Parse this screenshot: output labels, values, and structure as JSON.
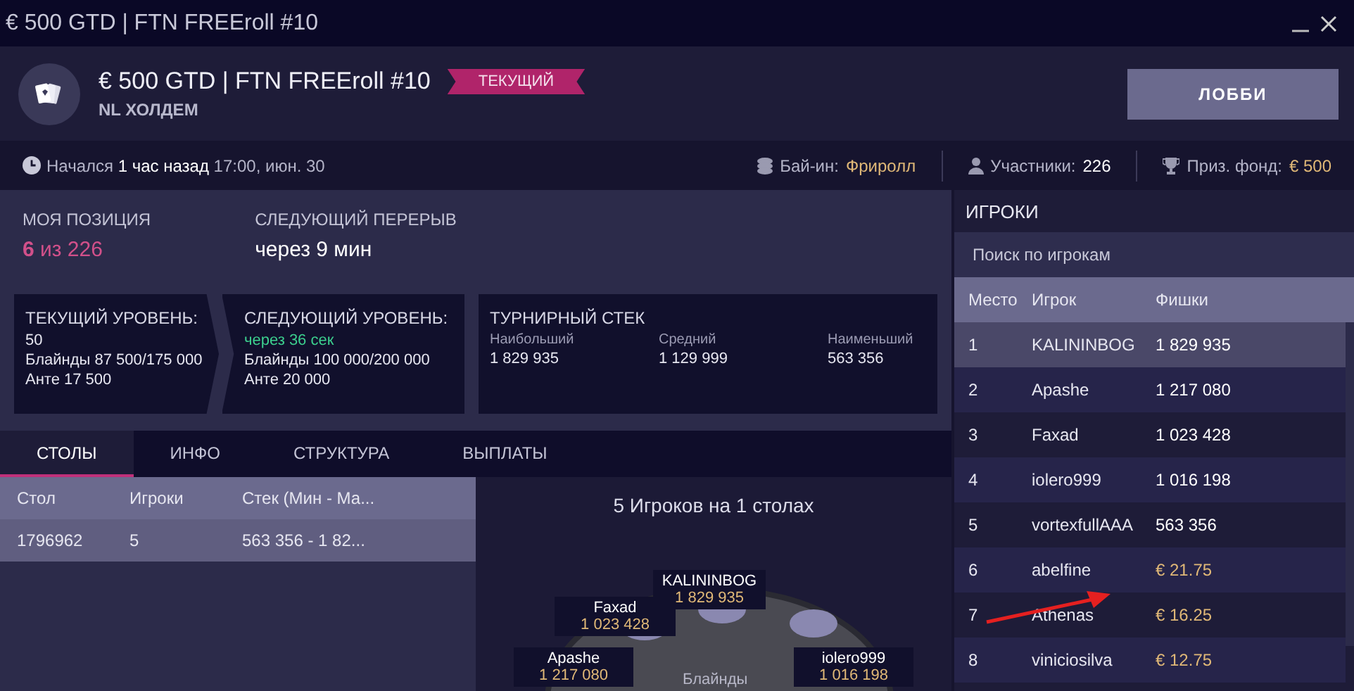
{
  "window": {
    "title": "€ 500 GTD | FTN FREEroll #10"
  },
  "header": {
    "title": "€ 500 GTD | FTN FREEroll #10",
    "badge": "ТЕКУЩИЙ",
    "subtitle": "NL ХОЛДЕМ",
    "lobby_button": "ЛОББИ"
  },
  "info_bar": {
    "started": "Начался **1 час назад** 17:00, июн. 30",
    "buy_in_label": "Бай-ин:",
    "buy_in_value": "Фриролл",
    "players_label": "Участники:",
    "players_value": "226",
    "prize_label": "Приз. фонд:",
    "prize_value": "€ 500"
  },
  "position": {
    "label": "МОЯ ПОЗИЦИЯ",
    "value": "**6** из 226",
    "break_label": "СЛЕДУЮЩИЙ ПЕРЕРЫВ",
    "break_value": "через 9 мин"
  },
  "levels": {
    "current_title": "ТЕКУЩИЙ УРОВЕНЬ:",
    "current_lines": [
      "50",
      "Блайнды 87 500/175 000",
      "Анте 17 500"
    ],
    "next_title": "СЛЕДУЮЩИЙ УРОВЕНЬ:",
    "next_countdown": "через 36 сек",
    "next_lines": [
      "Блайнды 100 000/200 000",
      "Анте 20 000"
    ]
  },
  "stack": {
    "title": "ТУРНИРНЫЙ СТЕК",
    "stats": [
      {
        "label": "Наибольший",
        "value": "1 829 935"
      },
      {
        "label": "Средний",
        "value": "1 129 999"
      },
      {
        "label": "Наименьший",
        "value": "563 356"
      }
    ]
  },
  "tabs": [
    {
      "label": "СТОЛЫ",
      "selected": true
    },
    {
      "label": "ИНФО",
      "selected": false
    },
    {
      "label": "СТРУКТУРА",
      "selected": false
    },
    {
      "label": "ВЫПЛАТЫ",
      "selected": false
    }
  ],
  "tables": {
    "columns": [
      "Стол",
      "Игроки",
      "Стек (Мин - Ма..."
    ],
    "rows": [
      {
        "cells": [
          "1796962",
          "5",
          "563 356 - 1 82..."
        ],
        "selected": true
      }
    ]
  },
  "table_view": {
    "title": "5 Игроков на 1 столах",
    "center_label": "Блайнды",
    "seats": [
      {
        "name": "KALININBOG",
        "chips": "1 829 935"
      },
      {
        "name": "Faxad",
        "chips": "1 023 428"
      },
      {
        "name": "Apashe",
        "chips": "1 217 080"
      },
      {
        "name": "iolero999",
        "chips": "1 016 198"
      }
    ]
  },
  "players_panel": {
    "title": "ИГРОКИ",
    "search": {
      "placeholder": "Поиск по игрокам"
    },
    "columns": [
      "Место",
      "Игрок",
      "Фишки"
    ],
    "rows": [
      {
        "place": "1",
        "name": "KALININBOG",
        "amount": "1 829 935",
        "kind": "chips",
        "selected": true
      },
      {
        "place": "2",
        "name": "Apashe",
        "amount": "1 217 080",
        "kind": "chips",
        "selected": false
      },
      {
        "place": "3",
        "name": "Faxad",
        "amount": "1 023 428",
        "kind": "chips",
        "selected": false
      },
      {
        "place": "4",
        "name": "iolero999",
        "amount": "1 016 198",
        "kind": "chips",
        "selected": false
      },
      {
        "place": "5",
        "name": "vortexfullAAA",
        "amount": "563 356",
        "kind": "chips",
        "selected": false
      },
      {
        "place": "6",
        "name": "abelfine",
        "amount": "€ 21.75",
        "kind": "prize",
        "selected": false
      },
      {
        "place": "7",
        "name": "Athenas",
        "amount": "€ 16.25",
        "kind": "prize",
        "selected": false
      },
      {
        "place": "8",
        "name": "viniciosilva",
        "amount": "€ 12.75",
        "kind": "prize",
        "selected": false
      }
    ]
  }
}
